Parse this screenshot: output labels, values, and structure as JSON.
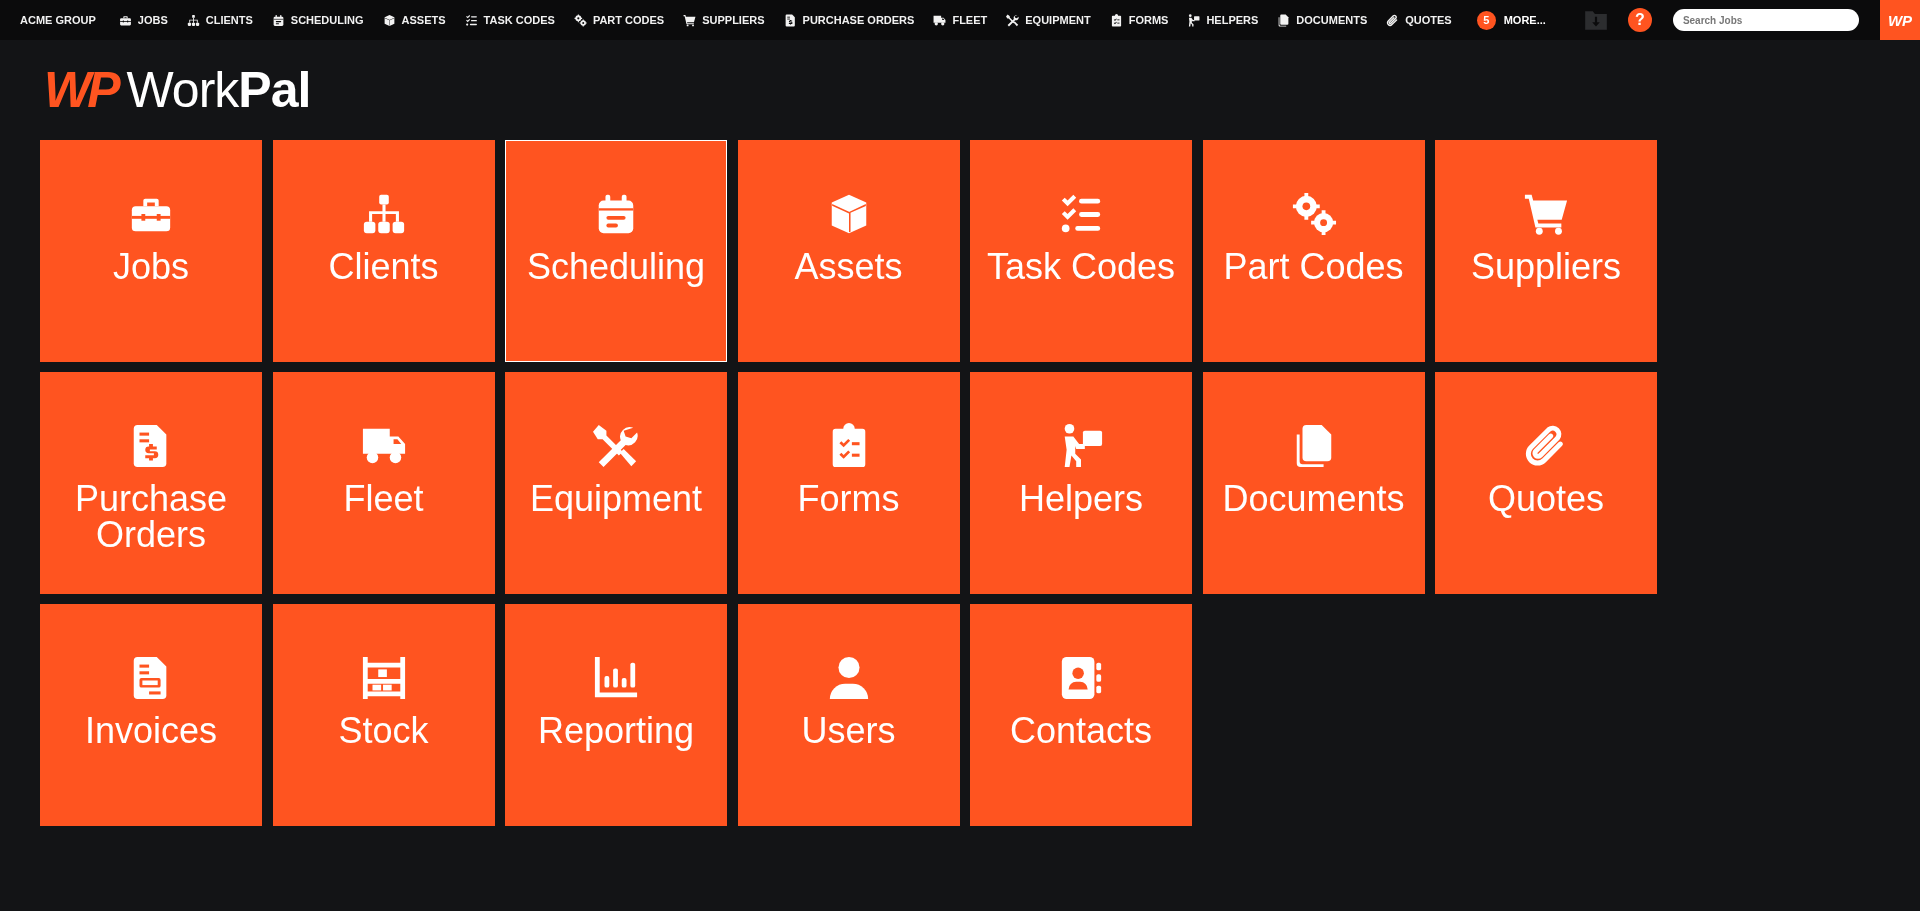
{
  "nav": {
    "brand": "ACME GROUP",
    "items": [
      {
        "label": "JOBS"
      },
      {
        "label": "CLIENTS"
      },
      {
        "label": "SCHEDULING"
      },
      {
        "label": "ASSETS"
      },
      {
        "label": "TASK CODES"
      },
      {
        "label": "PART CODES"
      },
      {
        "label": "SUPPLIERS"
      },
      {
        "label": "PURCHASE ORDERS"
      },
      {
        "label": "FLEET"
      },
      {
        "label": "EQUIPMENT"
      },
      {
        "label": "FORMS"
      },
      {
        "label": "HELPERS"
      },
      {
        "label": "DOCUMENTS"
      },
      {
        "label": "QUOTES"
      }
    ],
    "more": {
      "count": "5",
      "label": "MORE..."
    },
    "help": "?",
    "search": {
      "placeholder": "Search Jobs"
    },
    "badge": "WP"
  },
  "logo": {
    "mark": "WP",
    "name": "Work**Pal**"
  },
  "tiles": [
    {
      "label": "Jobs",
      "hovered": false
    },
    {
      "label": "Clients",
      "hovered": false
    },
    {
      "label": "Scheduling",
      "hovered": true
    },
    {
      "label": "Assets",
      "hovered": false
    },
    {
      "label": "Task Codes",
      "hovered": false
    },
    {
      "label": "Part Codes",
      "hovered": false
    },
    {
      "label": "Suppliers",
      "hovered": false
    },
    {
      "label": "Purchase Orders",
      "hovered": false
    },
    {
      "label": "Fleet",
      "hovered": false
    },
    {
      "label": "Equipment",
      "hovered": false
    },
    {
      "label": "Forms",
      "hovered": false
    },
    {
      "label": "Helpers",
      "hovered": false
    },
    {
      "label": "Documents",
      "hovered": false
    },
    {
      "label": "Quotes",
      "hovered": false
    },
    {
      "label": "Invoices",
      "hovered": false
    },
    {
      "label": "Stock",
      "hovered": false
    },
    {
      "label": "Reporting",
      "hovered": false
    },
    {
      "label": "Users",
      "hovered": false
    },
    {
      "label": "Contacts",
      "hovered": false
    }
  ]
}
